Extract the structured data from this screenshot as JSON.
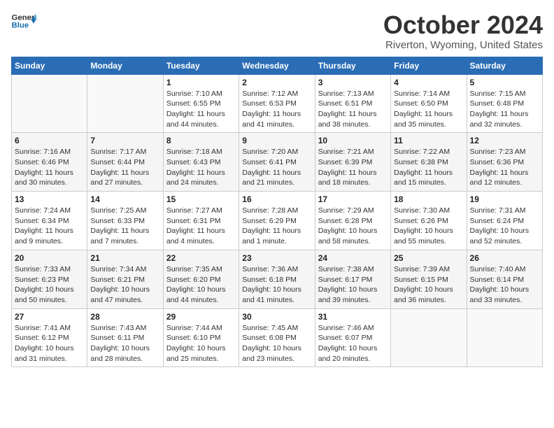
{
  "header": {
    "logo_line1": "General",
    "logo_line2": "Blue",
    "title": "October 2024",
    "subtitle": "Riverton, Wyoming, United States"
  },
  "weekdays": [
    "Sunday",
    "Monday",
    "Tuesday",
    "Wednesday",
    "Thursday",
    "Friday",
    "Saturday"
  ],
  "weeks": [
    [
      {
        "day": "",
        "info": ""
      },
      {
        "day": "",
        "info": ""
      },
      {
        "day": "1",
        "info": "Sunrise: 7:10 AM\nSunset: 6:55 PM\nDaylight: 11 hours and 44 minutes."
      },
      {
        "day": "2",
        "info": "Sunrise: 7:12 AM\nSunset: 6:53 PM\nDaylight: 11 hours and 41 minutes."
      },
      {
        "day": "3",
        "info": "Sunrise: 7:13 AM\nSunset: 6:51 PM\nDaylight: 11 hours and 38 minutes."
      },
      {
        "day": "4",
        "info": "Sunrise: 7:14 AM\nSunset: 6:50 PM\nDaylight: 11 hours and 35 minutes."
      },
      {
        "day": "5",
        "info": "Sunrise: 7:15 AM\nSunset: 6:48 PM\nDaylight: 11 hours and 32 minutes."
      }
    ],
    [
      {
        "day": "6",
        "info": "Sunrise: 7:16 AM\nSunset: 6:46 PM\nDaylight: 11 hours and 30 minutes."
      },
      {
        "day": "7",
        "info": "Sunrise: 7:17 AM\nSunset: 6:44 PM\nDaylight: 11 hours and 27 minutes."
      },
      {
        "day": "8",
        "info": "Sunrise: 7:18 AM\nSunset: 6:43 PM\nDaylight: 11 hours and 24 minutes."
      },
      {
        "day": "9",
        "info": "Sunrise: 7:20 AM\nSunset: 6:41 PM\nDaylight: 11 hours and 21 minutes."
      },
      {
        "day": "10",
        "info": "Sunrise: 7:21 AM\nSunset: 6:39 PM\nDaylight: 11 hours and 18 minutes."
      },
      {
        "day": "11",
        "info": "Sunrise: 7:22 AM\nSunset: 6:38 PM\nDaylight: 11 hours and 15 minutes."
      },
      {
        "day": "12",
        "info": "Sunrise: 7:23 AM\nSunset: 6:36 PM\nDaylight: 11 hours and 12 minutes."
      }
    ],
    [
      {
        "day": "13",
        "info": "Sunrise: 7:24 AM\nSunset: 6:34 PM\nDaylight: 11 hours and 9 minutes."
      },
      {
        "day": "14",
        "info": "Sunrise: 7:25 AM\nSunset: 6:33 PM\nDaylight: 11 hours and 7 minutes."
      },
      {
        "day": "15",
        "info": "Sunrise: 7:27 AM\nSunset: 6:31 PM\nDaylight: 11 hours and 4 minutes."
      },
      {
        "day": "16",
        "info": "Sunrise: 7:28 AM\nSunset: 6:29 PM\nDaylight: 11 hours and 1 minute."
      },
      {
        "day": "17",
        "info": "Sunrise: 7:29 AM\nSunset: 6:28 PM\nDaylight: 10 hours and 58 minutes."
      },
      {
        "day": "18",
        "info": "Sunrise: 7:30 AM\nSunset: 6:26 PM\nDaylight: 10 hours and 55 minutes."
      },
      {
        "day": "19",
        "info": "Sunrise: 7:31 AM\nSunset: 6:24 PM\nDaylight: 10 hours and 52 minutes."
      }
    ],
    [
      {
        "day": "20",
        "info": "Sunrise: 7:33 AM\nSunset: 6:23 PM\nDaylight: 10 hours and 50 minutes."
      },
      {
        "day": "21",
        "info": "Sunrise: 7:34 AM\nSunset: 6:21 PM\nDaylight: 10 hours and 47 minutes."
      },
      {
        "day": "22",
        "info": "Sunrise: 7:35 AM\nSunset: 6:20 PM\nDaylight: 10 hours and 44 minutes."
      },
      {
        "day": "23",
        "info": "Sunrise: 7:36 AM\nSunset: 6:18 PM\nDaylight: 10 hours and 41 minutes."
      },
      {
        "day": "24",
        "info": "Sunrise: 7:38 AM\nSunset: 6:17 PM\nDaylight: 10 hours and 39 minutes."
      },
      {
        "day": "25",
        "info": "Sunrise: 7:39 AM\nSunset: 6:15 PM\nDaylight: 10 hours and 36 minutes."
      },
      {
        "day": "26",
        "info": "Sunrise: 7:40 AM\nSunset: 6:14 PM\nDaylight: 10 hours and 33 minutes."
      }
    ],
    [
      {
        "day": "27",
        "info": "Sunrise: 7:41 AM\nSunset: 6:12 PM\nDaylight: 10 hours and 31 minutes."
      },
      {
        "day": "28",
        "info": "Sunrise: 7:43 AM\nSunset: 6:11 PM\nDaylight: 10 hours and 28 minutes."
      },
      {
        "day": "29",
        "info": "Sunrise: 7:44 AM\nSunset: 6:10 PM\nDaylight: 10 hours and 25 minutes."
      },
      {
        "day": "30",
        "info": "Sunrise: 7:45 AM\nSunset: 6:08 PM\nDaylight: 10 hours and 23 minutes."
      },
      {
        "day": "31",
        "info": "Sunrise: 7:46 AM\nSunset: 6:07 PM\nDaylight: 10 hours and 20 minutes."
      },
      {
        "day": "",
        "info": ""
      },
      {
        "day": "",
        "info": ""
      }
    ]
  ]
}
